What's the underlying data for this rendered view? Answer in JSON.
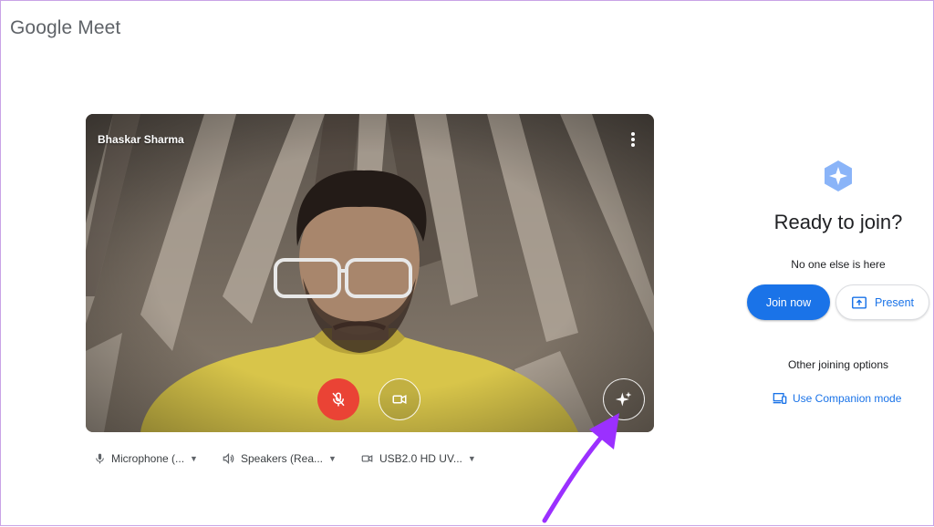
{
  "app": {
    "logo_text": "Google Meet"
  },
  "preview": {
    "participant_name": "Bhaskar Sharma",
    "microphone_muted": true,
    "camera_on": true
  },
  "devices": {
    "microphone": "Microphone (...",
    "speakers": "Speakers (Rea...",
    "camera": "USB2.0 HD UV..."
  },
  "join_panel": {
    "title": "Ready to join?",
    "status": "No one else is here",
    "join_label": "Join now",
    "present_label": "Present",
    "other_options": "Other joining options",
    "companion_label": "Use Companion mode"
  },
  "annotation": {
    "arrow_color": "#9b30ff"
  },
  "colors": {
    "accent": "#1a73e8",
    "mute_red": "#ea4335"
  }
}
